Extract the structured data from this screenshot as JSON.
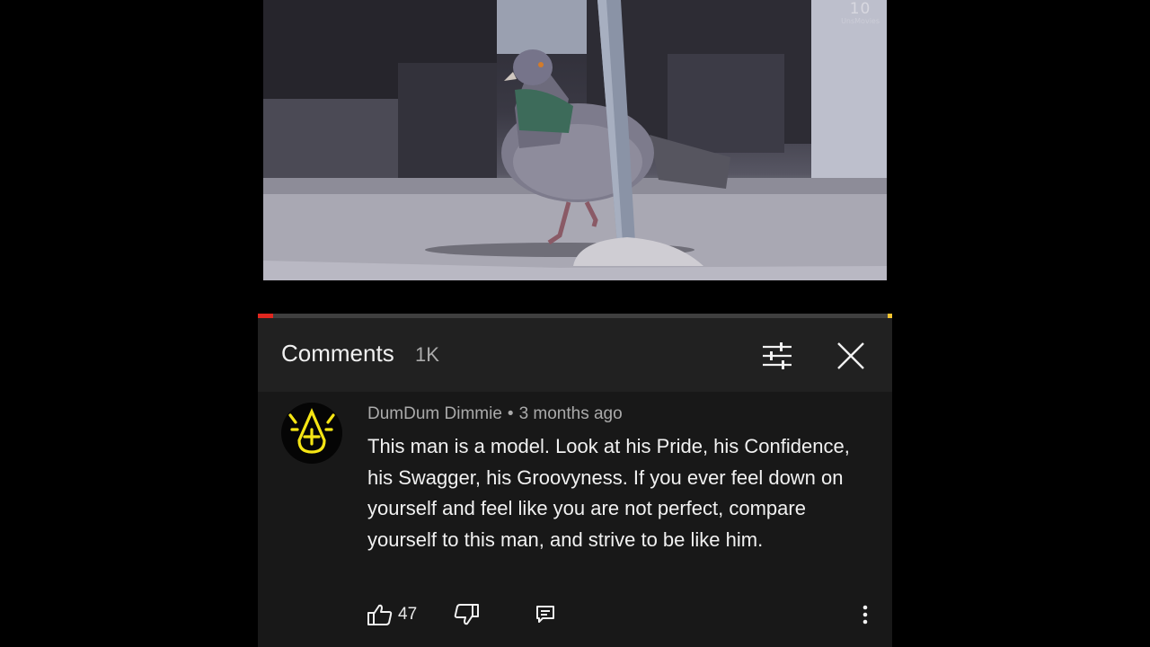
{
  "video": {
    "watermark_number": "10",
    "watermark_brand": "UnsMovies"
  },
  "player": {
    "progress_percent": 2.4
  },
  "comments_panel": {
    "title": "Comments",
    "count": "1K"
  },
  "comment": {
    "author": "DumDum Dimmie",
    "separator": "•",
    "time": "3 months ago",
    "text": "This man is a model. Look at his Pride, his Confidence, his Swagger, his Groovyness. If you ever feel down on yourself and feel like you are not perfect, compare yourself to this man, and strive to be like him.",
    "likes": "47"
  },
  "colors": {
    "accent_red": "#e0271f",
    "avatar_yellow": "#f5e514",
    "panel_bg": "#212121"
  },
  "icons": {
    "filter": "sliders-icon",
    "close": "close-icon",
    "like": "thumbs-up-icon",
    "dislike": "thumbs-down-icon",
    "reply": "reply-icon",
    "more": "more-vertical-icon"
  }
}
